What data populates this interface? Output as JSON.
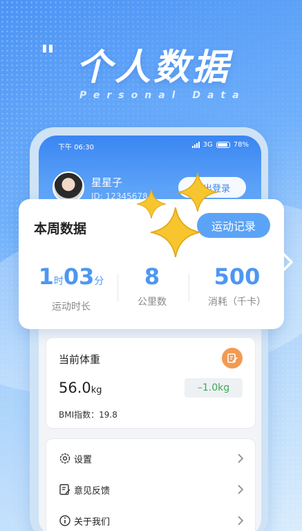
{
  "headline": {
    "quote": "\"",
    "title": "个人数据",
    "subtitle": "Personal Data"
  },
  "status_bar": {
    "time": "下午 06:30",
    "network": "3G",
    "battery": "78%"
  },
  "profile": {
    "name": "星星子",
    "id": "ID: 12345678",
    "logout_label": "退出登录"
  },
  "weekly": {
    "title": "本周数据",
    "record_button": "运动记录",
    "duration": {
      "hours": "1",
      "hours_unit": "时",
      "minutes": "03",
      "minutes_unit": "分",
      "label": "运动时长"
    },
    "distance": {
      "value": "8",
      "label": "公里数"
    },
    "calories": {
      "value": "500",
      "label": "消耗（千卡）"
    }
  },
  "weight": {
    "title": "当前体重",
    "value": "56.0",
    "unit": "kg",
    "change": "–1.0kg",
    "bmi": "BMI指数：19.8"
  },
  "menu": {
    "items": [
      {
        "label": "设置",
        "icon": "gear-icon"
      },
      {
        "label": "意见反馈",
        "icon": "feedback-icon"
      },
      {
        "label": "关于我们",
        "icon": "info-icon"
      }
    ]
  },
  "colors": {
    "accent": "#4d97f2",
    "button": "#5ba3f7",
    "edit_icon": "#f39a52",
    "delta_text": "#3da858",
    "sparkle": "#f7c52d"
  }
}
